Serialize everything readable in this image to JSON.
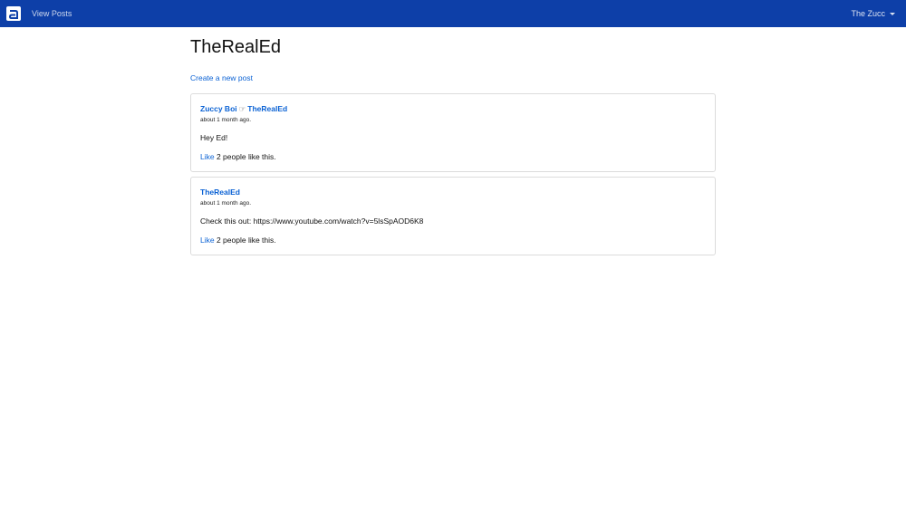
{
  "navbar": {
    "logo_icon": "app-logo-icon",
    "view_posts_label": "View Posts",
    "user_name": "The Zucc",
    "background": "#0d3fa8"
  },
  "page": {
    "title": "TheRealEd",
    "create_post_label": "Create a new post"
  },
  "posts": [
    {
      "author": "Zuccy Boi",
      "arrow": "☞",
      "recipient": "TheRealEd",
      "timestamp": "about 1 month ago.",
      "body": "Hey Ed!",
      "like_label": "Like",
      "like_count_text": "2 people like this."
    },
    {
      "author": "TheRealEd",
      "timestamp": "about 1 month ago.",
      "body": "Check this out: https://www.youtube.com/watch?v=5lsSpAOD6K8",
      "like_label": "Like",
      "like_count_text": "2 people like this."
    }
  ],
  "colors": {
    "link": "#0b62d4",
    "card_border": "#dcdcdc"
  }
}
